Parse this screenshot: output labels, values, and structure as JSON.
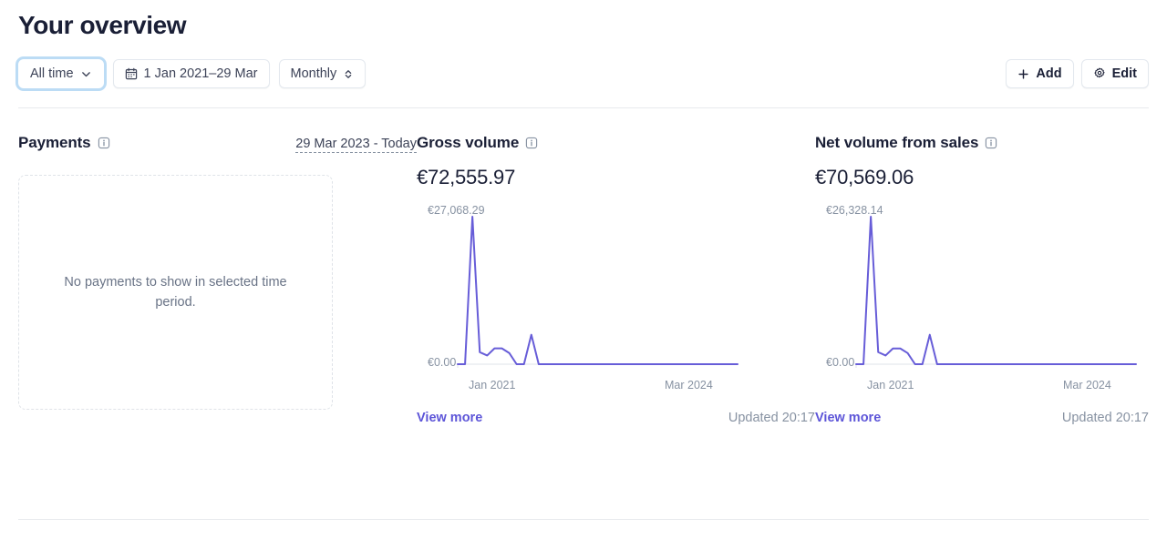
{
  "header": {
    "title": "Your overview",
    "time_filter": {
      "label": "All time",
      "icon": "chevron-down-icon"
    },
    "date_range": {
      "label": "1 Jan 2021–29 Mar",
      "icon": "calendar-icon"
    },
    "interval": {
      "label": "Monthly",
      "icon": "chevron-up-down-icon"
    },
    "add_button": {
      "label": "Add",
      "icon": "plus-icon"
    },
    "edit_button": {
      "label": "Edit",
      "icon": "gear-icon"
    }
  },
  "payments": {
    "title": "Payments",
    "info_icon": "info-icon",
    "date_range": "29 Mar 2023 - Today",
    "empty_text": "No payments to show in selected time period."
  },
  "gross_volume": {
    "title": "Gross volume",
    "info_icon": "info-icon",
    "amount": "€72,555.97",
    "view_more": "View more",
    "updated": "Updated 20:17"
  },
  "net_volume": {
    "title": "Net volume from sales",
    "info_icon": "info-icon",
    "amount": "€70,569.06",
    "view_more": "View more",
    "updated": "Updated 20:17"
  },
  "colors": {
    "line": "#675dd8",
    "link": "#5d55d8",
    "muted": "#8792a2",
    "text": "#1a1f36",
    "border": "#e3e8ee",
    "focus_ring": "#bcdcf5"
  },
  "chart_data": [
    {
      "type": "line",
      "title": "Gross volume",
      "ylabel": "",
      "xlabel": "",
      "ymax_label": "€27,068.29",
      "ymin_label": "€0.00",
      "ylim": [
        0,
        27068.29
      ],
      "x_start_label": "Jan 2021",
      "x_end_label": "Mar 2024",
      "grid": false,
      "legend": "none",
      "x": [
        "Jan 2021",
        "Feb 2021",
        "Mar 2021",
        "Apr 2021",
        "May 2021",
        "Jun 2021",
        "Jul 2021",
        "Aug 2021",
        "Sep 2021",
        "Oct 2021",
        "Nov 2021",
        "Dec 2021",
        "Jan 2022",
        "Feb 2022",
        "Mar 2022",
        "Apr 2022",
        "May 2022",
        "Jun 2022",
        "Jul 2022",
        "Aug 2022",
        "Sep 2022",
        "Oct 2022",
        "Nov 2022",
        "Dec 2022",
        "Jan 2023",
        "Feb 2023",
        "Mar 2023",
        "Apr 2023",
        "May 2023",
        "Jun 2023",
        "Jul 2023",
        "Aug 2023",
        "Sep 2023",
        "Oct 2023",
        "Nov 2023",
        "Dec 2023",
        "Jan 2024",
        "Feb 2024",
        "Mar 2024"
      ],
      "values": [
        0,
        0,
        27068.29,
        2200,
        1600,
        2900,
        2900,
        2050,
        0,
        0,
        5400,
        0,
        0,
        0,
        0,
        0,
        0,
        0,
        0,
        0,
        0,
        0,
        0,
        0,
        0,
        0,
        0,
        0,
        0,
        0,
        0,
        0,
        0,
        0,
        0,
        0,
        0,
        0,
        0
      ]
    },
    {
      "type": "line",
      "title": "Net volume from sales",
      "ylabel": "",
      "xlabel": "",
      "ymax_label": "€26,328.14",
      "ymin_label": "€0.00",
      "ylim": [
        0,
        26328.14
      ],
      "x_start_label": "Jan 2021",
      "x_end_label": "Mar 2024",
      "grid": false,
      "legend": "none",
      "x": [
        "Jan 2021",
        "Feb 2021",
        "Mar 2021",
        "Apr 2021",
        "May 2021",
        "Jun 2021",
        "Jul 2021",
        "Aug 2021",
        "Sep 2021",
        "Oct 2021",
        "Nov 2021",
        "Dec 2021",
        "Jan 2022",
        "Feb 2022",
        "Mar 2022",
        "Apr 2022",
        "May 2022",
        "Jun 2022",
        "Jul 2022",
        "Aug 2022",
        "Sep 2022",
        "Oct 2022",
        "Nov 2022",
        "Dec 2022",
        "Jan 2023",
        "Feb 2023",
        "Mar 2023",
        "Apr 2023",
        "May 2023",
        "Jun 2023",
        "Jul 2023",
        "Aug 2023",
        "Sep 2023",
        "Oct 2023",
        "Nov 2023",
        "Dec 2023",
        "Jan 2024",
        "Feb 2024",
        "Mar 2024"
      ],
      "values": [
        0,
        0,
        26328.14,
        2150,
        1550,
        2800,
        2800,
        1980,
        0,
        0,
        5250,
        0,
        0,
        0,
        0,
        0,
        0,
        0,
        0,
        0,
        0,
        0,
        0,
        0,
        0,
        0,
        0,
        0,
        0,
        0,
        0,
        0,
        0,
        0,
        0,
        0,
        0,
        0,
        0
      ]
    }
  ]
}
